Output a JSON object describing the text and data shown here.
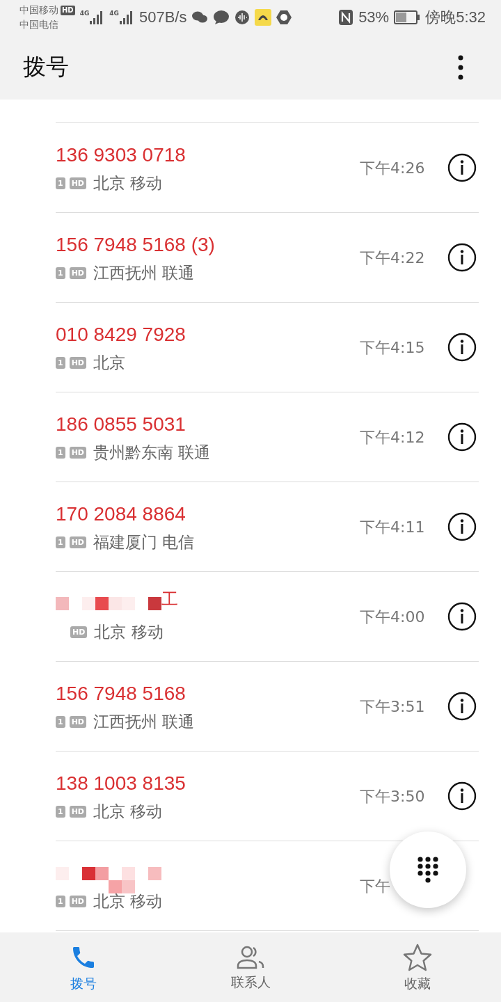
{
  "status_bar": {
    "carriers": [
      "中国移动",
      "中国电信"
    ],
    "hd": "HD",
    "signals": [
      "4G",
      "4G"
    ],
    "speed": "507B/s",
    "battery": "53%",
    "time": "傍晚5:32"
  },
  "header": {
    "title": "拨号"
  },
  "calls": [
    {
      "kind": "number",
      "number": "136 9303 0718",
      "sim": "1",
      "hd": "HD",
      "location": "北京 移动",
      "time": "下午4:26",
      "missed": true,
      "info_icon": true
    },
    {
      "kind": "number",
      "number": "156 7948 5168  (3)",
      "sim": "1",
      "hd": "HD",
      "location": "江西抚州 联通",
      "time": "下午4:22",
      "missed": true,
      "info_icon": true
    },
    {
      "kind": "number",
      "number": "010 8429 7928",
      "sim": "1",
      "hd": "HD",
      "location": "北京",
      "time": "下午4:15",
      "missed": true,
      "info_icon": true
    },
    {
      "kind": "number",
      "number": "186 0855 5031",
      "sim": "1",
      "hd": "HD",
      "location": "贵州黔东南 联通",
      "time": "下午4:12",
      "missed": true,
      "info_icon": true
    },
    {
      "kind": "number",
      "number": "170 2084 8864",
      "sim": "1",
      "hd": "HD",
      "location": "福建厦门 电信",
      "time": "下午4:11",
      "missed": true,
      "info_icon": true
    },
    {
      "kind": "redacted",
      "fragment": "工",
      "hd": "HD",
      "location": "北京 移动",
      "time": "下午4:00",
      "missed": true,
      "info_icon": true
    },
    {
      "kind": "number",
      "number": "156 7948 5168",
      "sim": "1",
      "hd": "HD",
      "location": "江西抚州 联通",
      "time": "下午3:51",
      "missed": true,
      "info_icon": true
    },
    {
      "kind": "number",
      "number": "138 1003 8135",
      "sim": "1",
      "hd": "HD",
      "location": "北京 移动",
      "time": "下午3:50",
      "missed": true,
      "info_icon": true
    },
    {
      "kind": "redacted",
      "sim": "1",
      "hd": "HD",
      "location": "北京 移动",
      "time": "下午",
      "missed": true,
      "info_icon": false
    }
  ],
  "bottom_nav": [
    {
      "label": "拨号",
      "selected": true
    },
    {
      "label": "联系人",
      "selected": false
    },
    {
      "label": "收藏",
      "selected": false
    }
  ]
}
